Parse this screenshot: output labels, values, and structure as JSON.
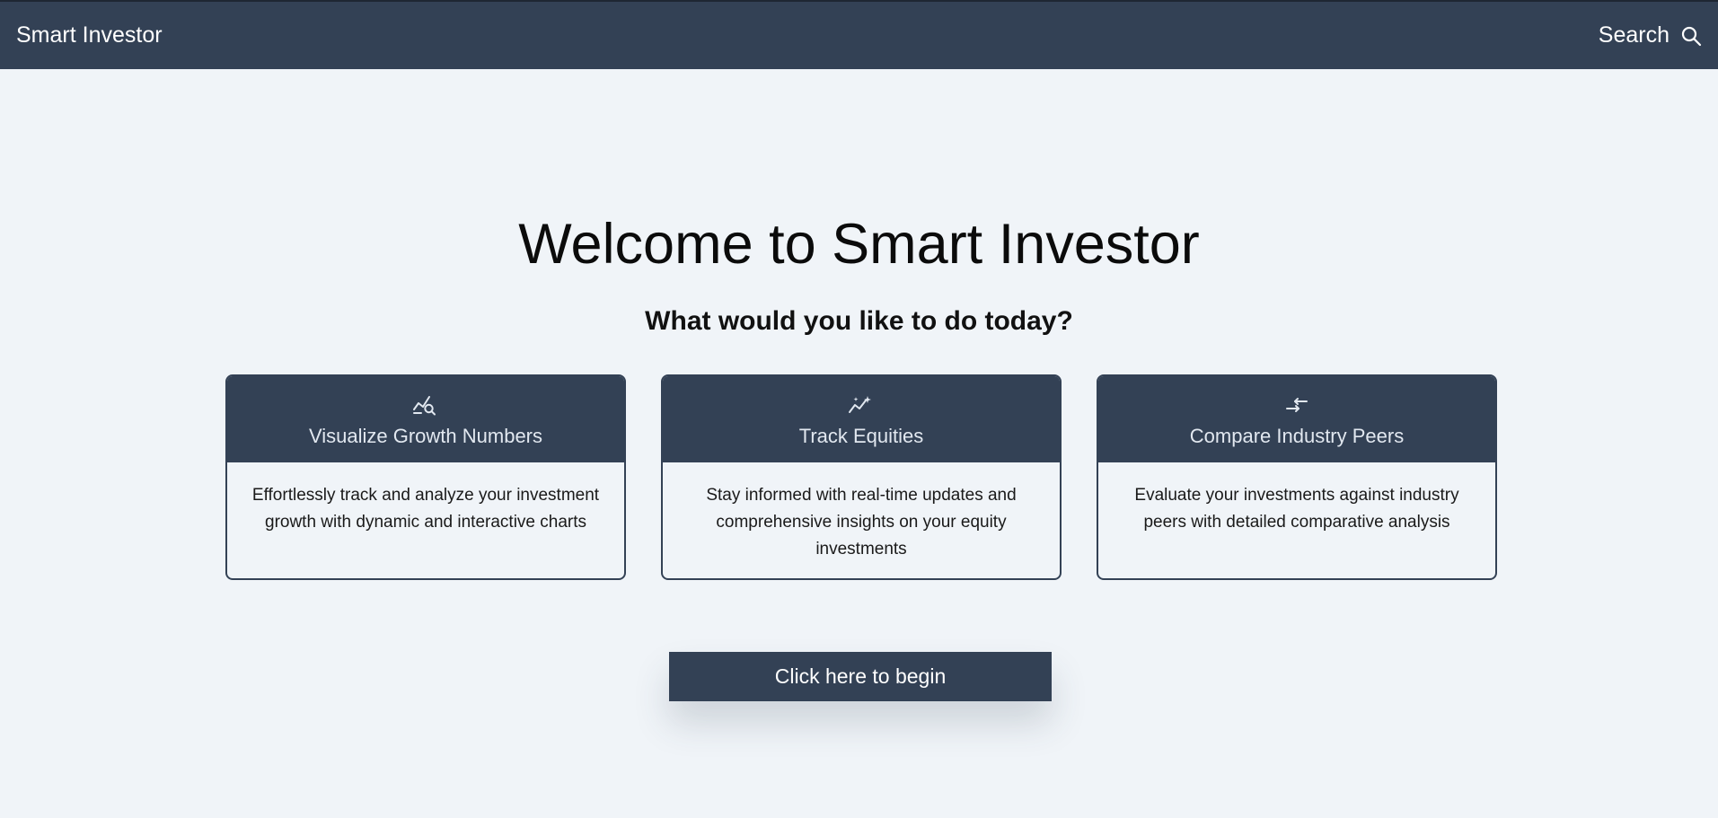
{
  "header": {
    "brand": "Smart Investor",
    "search_label": "Search",
    "search_icon": "search-icon"
  },
  "hero": {
    "title": "Welcome to Smart Investor",
    "subtitle": "What would you like to do today?"
  },
  "cards": [
    {
      "icon": "chart-magnifier-icon",
      "title": "Visualize Growth Numbers",
      "description": "Effortlessly track and analyze your investment growth with dynamic and interactive charts"
    },
    {
      "icon": "sparkle-trend-icon",
      "title": "Track Equities",
      "description": "Stay informed with real-time updates and comprehensive insights on your equity investments"
    },
    {
      "icon": "compare-arrows-icon",
      "title": "Compare Industry Peers",
      "description": "Evaluate your investments against industry peers with detailed comparative analysis"
    }
  ],
  "cta": {
    "label": "Click here to begin"
  },
  "colors": {
    "primary": "#334155",
    "background": "#f0f4f8",
    "card_title": "#e2e8f0"
  }
}
